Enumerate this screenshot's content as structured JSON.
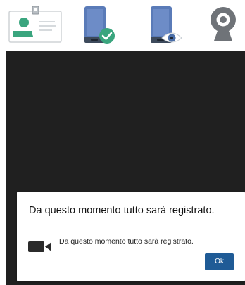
{
  "steps": [
    {
      "icon": "id-card-icon",
      "state": "done"
    },
    {
      "icon": "phone-check-icon",
      "state": "done"
    },
    {
      "icon": "phone-eye-icon",
      "state": "pending"
    },
    {
      "icon": "webcam-icon",
      "state": "pending"
    }
  ],
  "colors": {
    "accent_green": "#3aa57e",
    "icon_blue": "#5a7bb8",
    "icon_gray": "#6f7378",
    "camera_bg": "#202020",
    "button_blue": "#1f5b96"
  },
  "dialog": {
    "title": "Da questo momento tutto sarà registrato.",
    "message": "Da questo momento tutto sarà registrato.",
    "icon": "video-camera-icon",
    "ok_label": "Ok"
  }
}
